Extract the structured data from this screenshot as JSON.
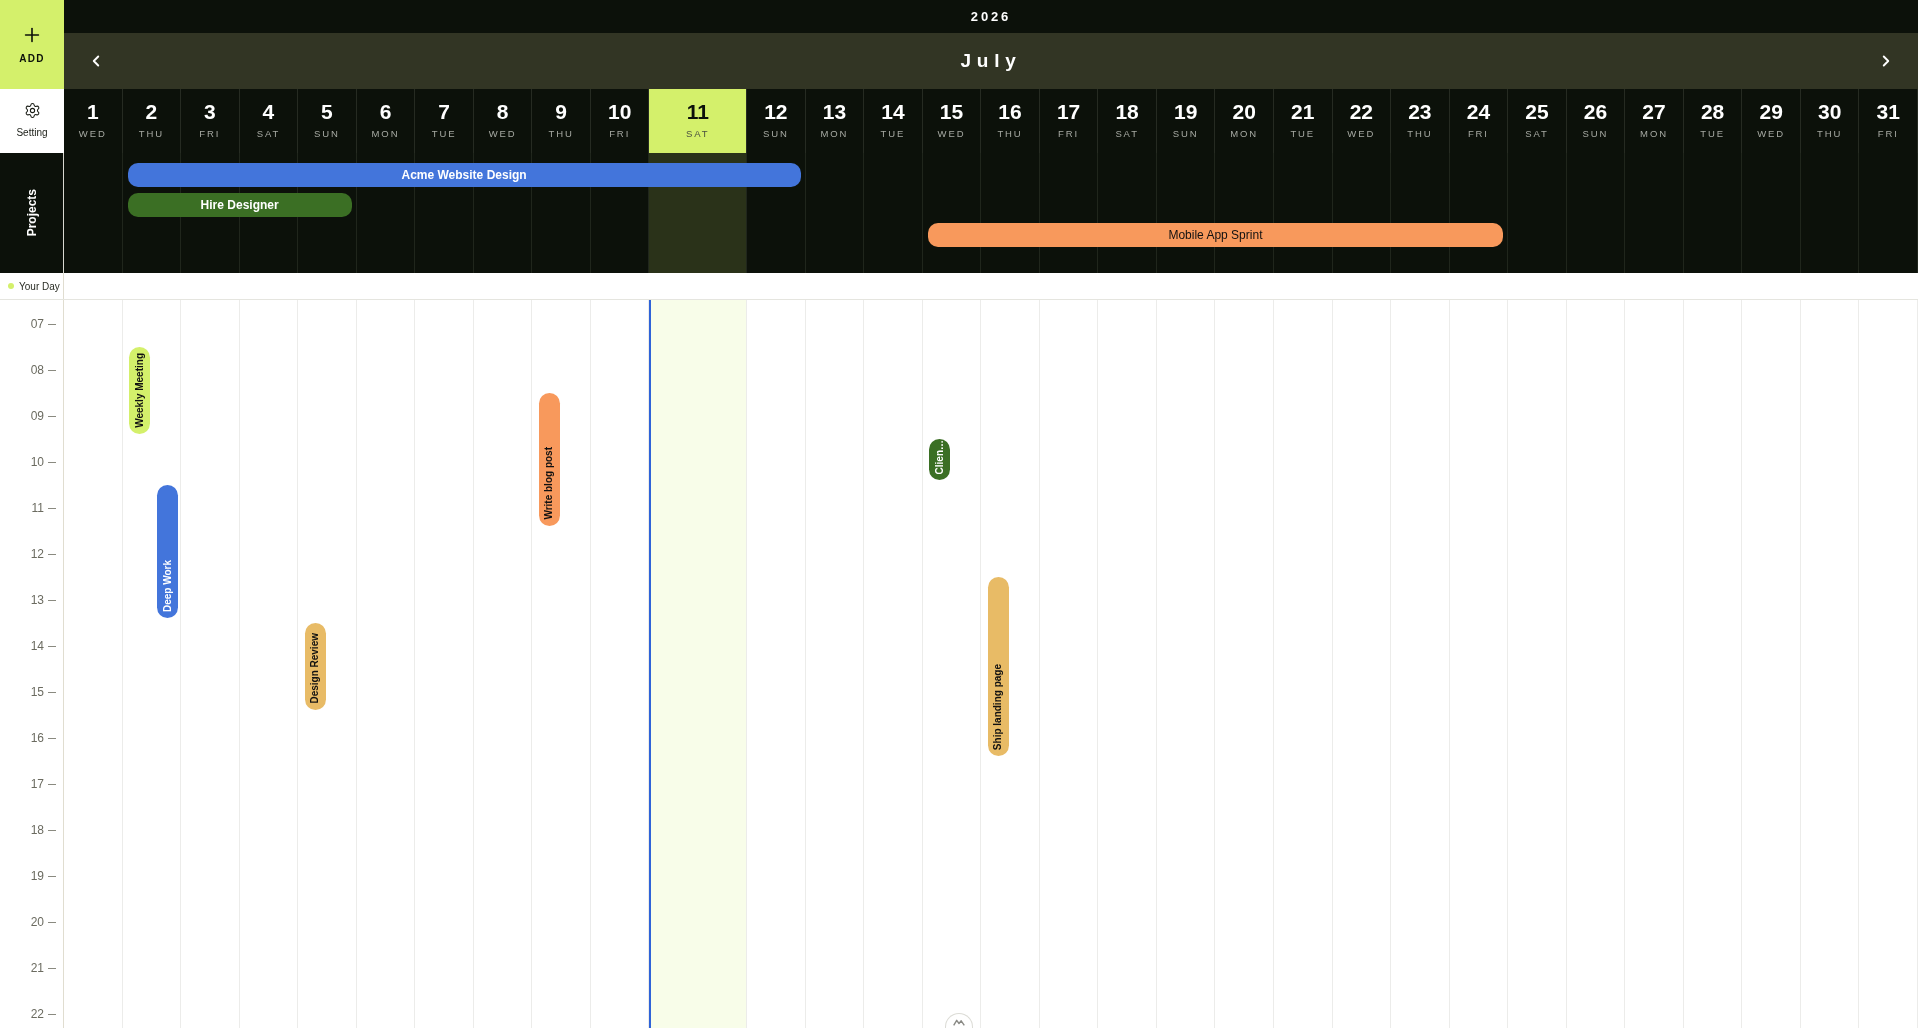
{
  "sidebar": {
    "add_button": {
      "label": "ADD"
    },
    "settings_button": {
      "label": "Setting"
    },
    "projects_panel": {
      "label": "Projects"
    }
  },
  "header": {
    "year": "2026",
    "month": "July"
  },
  "days": [
    {
      "number": "1",
      "weekday": "WED",
      "selected": false
    },
    {
      "number": "2",
      "weekday": "THU",
      "selected": false,
      "events": [
        {
          "title": "Weekly Meeting",
          "color": "#d4f06b"
        },
        {
          "title": "Deep Work",
          "color": "#4375db"
        }
      ]
    },
    {
      "number": "3",
      "weekday": "FRI",
      "selected": false
    },
    {
      "number": "4",
      "weekday": "SAT",
      "selected": false
    },
    {
      "number": "5",
      "weekday": "SUN",
      "selected": false,
      "events": [
        {
          "title": "Design Review",
          "color": "#e8bb66"
        }
      ]
    },
    {
      "number": "6",
      "weekday": "MON",
      "selected": false
    },
    {
      "number": "7",
      "weekday": "TUE",
      "selected": false
    },
    {
      "number": "8",
      "weekday": "WED",
      "selected": false
    },
    {
      "number": "9",
      "weekday": "THU",
      "selected": false,
      "events": [
        {
          "title": "Write blog post",
          "color": "#f8995c"
        }
      ]
    },
    {
      "number": "10",
      "weekday": "FRI",
      "selected": false
    },
    {
      "number": "11",
      "weekday": "SAT",
      "selected": true
    },
    {
      "number": "12",
      "weekday": "SUN",
      "selected": false
    },
    {
      "number": "13",
      "weekday": "MON",
      "selected": false
    },
    {
      "number": "14",
      "weekday": "TUE",
      "selected": false
    },
    {
      "number": "15",
      "weekday": "WED",
      "selected": false,
      "events": [
        {
          "title": "Clien…",
          "color": "#3b6f24"
        }
      ]
    },
    {
      "number": "16",
      "weekday": "THU",
      "selected": false,
      "events": [
        {
          "title": "Ship landing page",
          "color": "#e8bb66"
        }
      ]
    },
    {
      "number": "17",
      "weekday": "FRI",
      "selected": false
    },
    {
      "number": "18",
      "weekday": "SAT",
      "selected": false
    },
    {
      "number": "19",
      "weekday": "SUN",
      "selected": false
    },
    {
      "number": "20",
      "weekday": "MON",
      "selected": false
    },
    {
      "number": "21",
      "weekday": "TUE",
      "selected": false
    },
    {
      "number": "22",
      "weekday": "WED",
      "selected": false
    },
    {
      "number": "23",
      "weekday": "THU",
      "selected": false
    },
    {
      "number": "24",
      "weekday": "FRI",
      "selected": false
    },
    {
      "number": "25",
      "weekday": "SAT",
      "selected": false
    },
    {
      "number": "26",
      "weekday": "SUN",
      "selected": false
    },
    {
      "number": "27",
      "weekday": "MON",
      "selected": false
    },
    {
      "number": "28",
      "weekday": "TUE",
      "selected": false
    },
    {
      "number": "29",
      "weekday": "WED",
      "selected": false
    },
    {
      "number": "30",
      "weekday": "THU",
      "selected": false
    },
    {
      "number": "31",
      "weekday": "FRI",
      "selected": false
    }
  ],
  "projects": [
    {
      "name": "Acme Website Design",
      "color": "#4375db"
    },
    {
      "name": "Hire Designer",
      "color": "#3b6f24"
    },
    {
      "name": "Mobile App Sprint",
      "color": "#f8995c"
    }
  ],
  "your_day": {
    "label": "Your Day"
  },
  "hours": [
    "07",
    "08",
    "09",
    "10",
    "11",
    "12",
    "13",
    "14",
    "15",
    "16",
    "17",
    "18",
    "19",
    "20",
    "21",
    "22"
  ]
}
